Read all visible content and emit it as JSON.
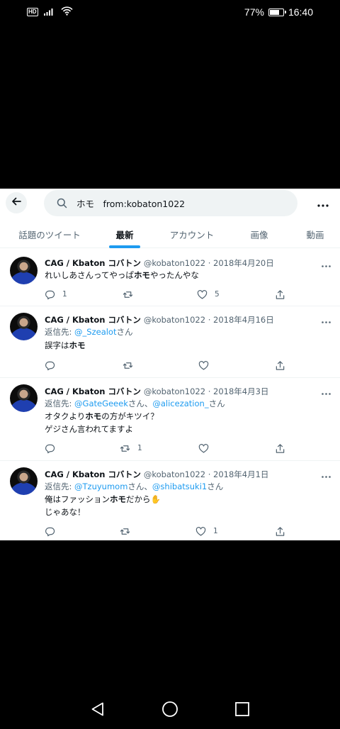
{
  "status_bar": {
    "network_badge": "HD",
    "battery_percent": "77%",
    "battery_level": 0.77,
    "time": "16:40"
  },
  "search": {
    "query": "ホモ　from:kobaton1022"
  },
  "tabs": [
    {
      "label": "話題のツイート",
      "active": false
    },
    {
      "label": "最新",
      "active": true
    },
    {
      "label": "アカウント",
      "active": false
    },
    {
      "label": "画像",
      "active": false
    },
    {
      "label": "動画",
      "active": false
    }
  ],
  "tweets": [
    {
      "name": "CAG / Kbaton コバトン",
      "handle_date": "@kobaton1022 · 2018年4月20日",
      "reply_prefix": "",
      "reply_links": [],
      "reply_suffixes": [],
      "lines": [
        {
          "pre": "れいしあさんってやっぱ",
          "bold": "ホモ",
          "post": "やったんやな"
        }
      ],
      "replies": "1",
      "retweets": "",
      "likes": "5"
    },
    {
      "name": "CAG / Kbaton コバトン",
      "handle_date": "@kobaton1022 · 2018年4月16日",
      "reply_prefix": "返信先: ",
      "reply_links": [
        "@_Szealot"
      ],
      "reply_suffixes": [
        "さん"
      ],
      "lines": [
        {
          "pre": "誤字は",
          "bold": "ホモ",
          "post": ""
        }
      ],
      "replies": "",
      "retweets": "",
      "likes": ""
    },
    {
      "name": "CAG / Kbaton コバトン",
      "handle_date": "@kobaton1022 · 2018年4月3日",
      "reply_prefix": "返信先: ",
      "reply_links": [
        "@GateGeeek",
        "@alicezation_"
      ],
      "reply_suffixes": [
        "さん、",
        "さん"
      ],
      "lines": [
        {
          "pre": "オタクより",
          "bold": "ホモ",
          "post": "の方がキツイ？"
        },
        {
          "pre": "ゲジさん言われてますよ",
          "bold": "",
          "post": ""
        }
      ],
      "replies": "",
      "retweets": "1",
      "likes": ""
    },
    {
      "name": "CAG / Kbaton コバトン",
      "handle_date": "@kobaton1022 · 2018年4月1日",
      "reply_prefix": "返信先: ",
      "reply_links": [
        "@Tzuyumom",
        "@shibatsuki1"
      ],
      "reply_suffixes": [
        "さん、",
        "さん"
      ],
      "lines": [
        {
          "pre": "俺はファッション",
          "bold": "ホモ",
          "post": "だから✋"
        },
        {
          "pre": "じゃあな！",
          "bold": "",
          "post": ""
        }
      ],
      "replies": "",
      "retweets": "",
      "likes": "1"
    }
  ],
  "icons": {
    "back": "arrow-left-icon",
    "search": "search-icon",
    "more": "more-horizontal-icon",
    "reply": "reply-icon",
    "retweet": "retweet-icon",
    "like": "heart-icon",
    "share": "share-icon",
    "nav_back": "triangle-back-icon",
    "nav_home": "circle-home-icon",
    "nav_recent": "square-recent-icon"
  },
  "colors": {
    "accent": "#1d9bf0",
    "text": "#0f1419",
    "secondary": "#536471",
    "panel": "#ffffff",
    "background": "#000000"
  }
}
